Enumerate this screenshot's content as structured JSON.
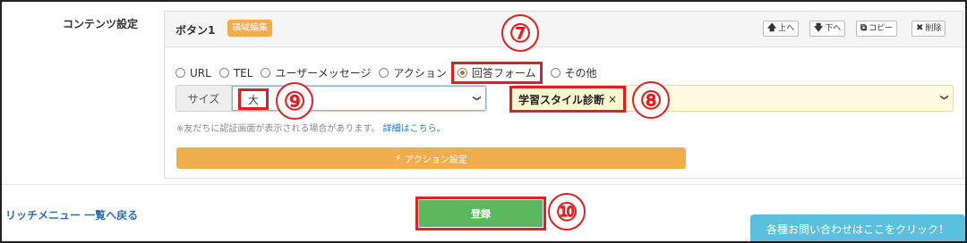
{
  "section": {
    "label": "コンテンツ設定"
  },
  "button_panel": {
    "title": "ボタン1",
    "area_badge": "領域編集",
    "toolbar": {
      "up": "上へ",
      "down": "下へ",
      "copy": "コピー",
      "delete": "削除"
    }
  },
  "action_types": [
    {
      "label": "URL",
      "selected": false
    },
    {
      "label": "TEL",
      "selected": false
    },
    {
      "label": "ユーザーメッセージ",
      "selected": false
    },
    {
      "label": "アクション",
      "selected": false
    },
    {
      "label": "回答フォーム",
      "selected": true
    },
    {
      "label": "その他",
      "selected": false
    }
  ],
  "size": {
    "addon": "サイズ",
    "value": "大"
  },
  "form": {
    "selected_tag": "学習スタイル診断"
  },
  "note": {
    "text": "※友だちに認証画面が表示される場合があります。",
    "link": "詳細はこちら。"
  },
  "action_settings": {
    "label": "アクション設定"
  },
  "footer": {
    "back_link": "リッチメニュー 一覧へ戻る",
    "register": "登録",
    "contact": "各種お問い合わせはここをクリック！"
  },
  "markers": [
    "⑦",
    "⑧",
    "⑨",
    "⑩"
  ],
  "colors": {
    "highlight": "#e02020",
    "badge": "#f0ad4e",
    "register": "#5cb85c",
    "contact": "#5bc0de",
    "link": "#2a6fb4"
  },
  "icons": {
    "up": "arrow-up-icon",
    "down": "arrow-down-icon",
    "copy": "copy-icon",
    "delete": "close-icon",
    "action": "bolt-icon",
    "select": "chevron-down-icon"
  }
}
